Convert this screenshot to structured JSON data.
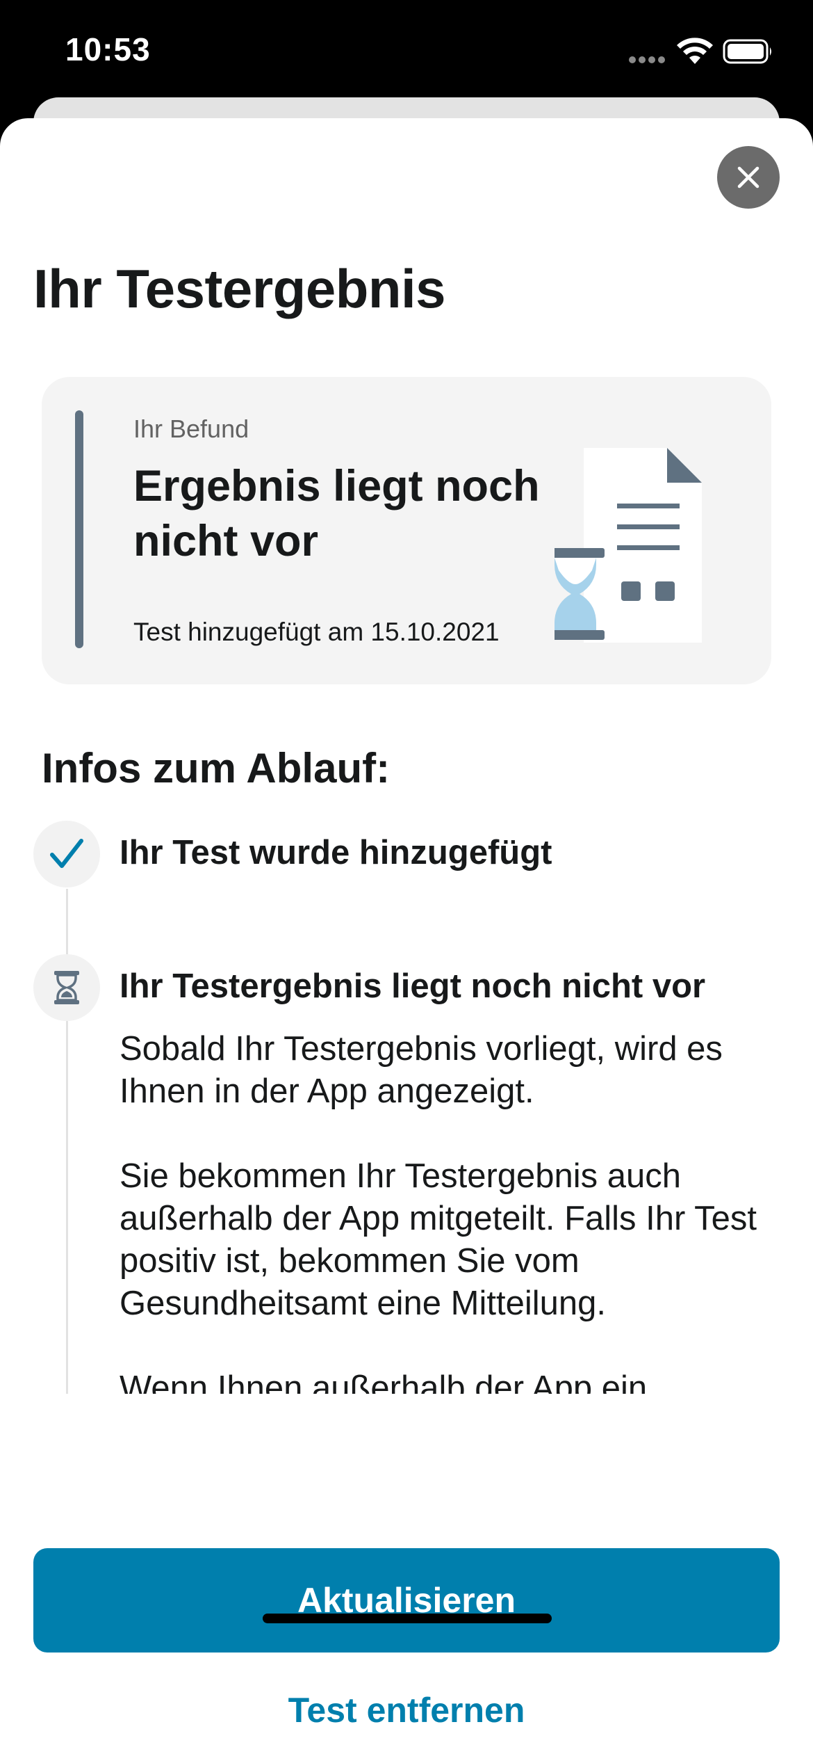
{
  "status_bar": {
    "time": "10:53"
  },
  "sheet": {
    "title": "Ihr Testergebnis",
    "result_card": {
      "label": "Ihr Befund",
      "status": "Ergebnis liegt noch nicht vor",
      "date_text": "Test hinzugefügt am 15.10.2021"
    },
    "info_section": {
      "title": "Infos zum Ablauf:",
      "steps": [
        {
          "icon": "checkmark-icon",
          "title": "Ihr Test wurde hinzugefügt"
        },
        {
          "icon": "hourglass-icon",
          "title": "Ihr Testergebnis liegt noch nicht vor",
          "paragraphs": [
            "Sobald Ihr Testergebnis vorliegt, wird es Ihnen in der App angezeigt.",
            "Sie bekommen Ihr Testergebnis auch außerhalb der App mitgeteilt. Falls Ihr Test positiv ist, bekommen Sie vom Gesundheitsamt eine Mitteilung.",
            "Wenn Ihnen außerhalb der App ein"
          ]
        }
      ]
    },
    "buttons": {
      "primary": "Aktualisieren",
      "secondary": "Test entfernen"
    }
  },
  "colors": {
    "accent": "#007fad",
    "card_bar": "#5f7181",
    "card_background": "#f4f4f4",
    "close_button": "#6b6b6b"
  }
}
